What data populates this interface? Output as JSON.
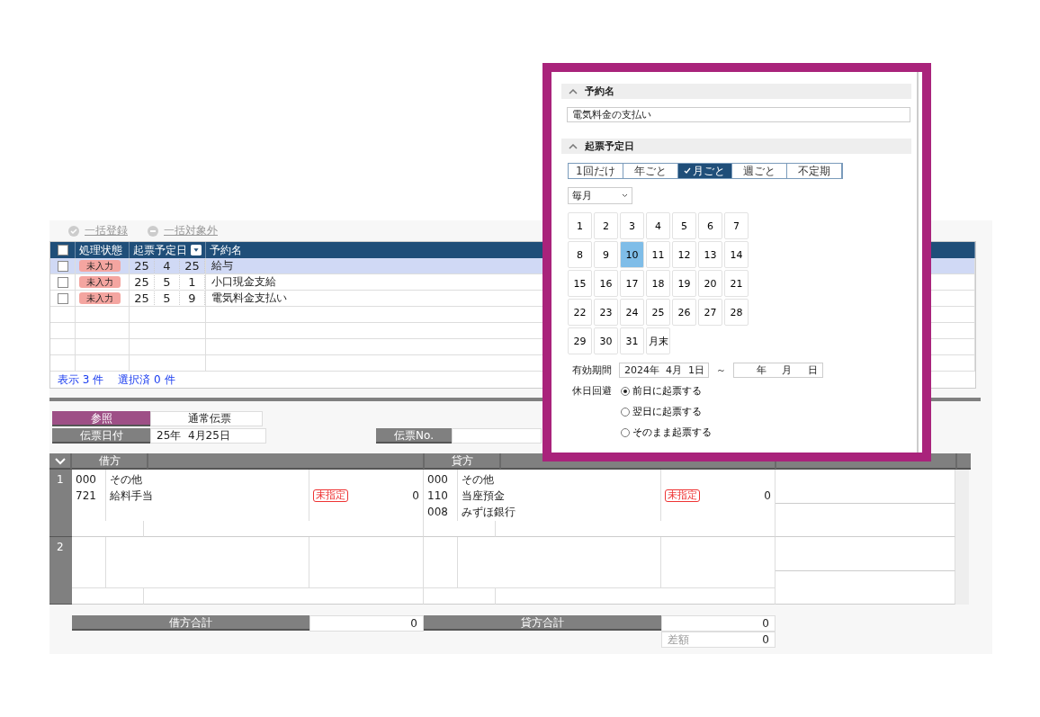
{
  "toolbar": [
    {
      "label": "一括登録",
      "kind": "register",
      "disabled": true
    },
    {
      "label": "一括対象外",
      "kind": "exclude",
      "disabled": true
    }
  ],
  "reservations": {
    "select_all_checked": false,
    "columns": [
      "処理状態",
      "起票予定日",
      "予約名"
    ],
    "rows": [
      {
        "checked": false,
        "selected": true,
        "status": "未入力",
        "date": [
          "25",
          "4",
          "25"
        ],
        "name": "給与"
      },
      {
        "checked": false,
        "selected": false,
        "status": "未入力",
        "date": [
          "25",
          "5",
          "1"
        ],
        "name": "小口現金支給"
      },
      {
        "checked": false,
        "selected": false,
        "status": "未入力",
        "date": [
          "25",
          "5",
          "9"
        ],
        "name": "電気料金支払い"
      }
    ],
    "footer": [
      "表示 3 件",
      "選択済 0 件"
    ]
  },
  "voucher": {
    "reference_label": "参照",
    "reference_value": "通常伝票",
    "date_label": "伝票日付",
    "date_value": "25年  4月25日",
    "number_label": "伝票No."
  },
  "journal": {
    "headers": {
      "debit": "借方",
      "credit": "貸方"
    },
    "rows": [
      {
        "number": "1",
        "debit": {
          "lines": [
            {
              "code": "000",
              "name": "その他"
            },
            {
              "code": "721",
              "name": "給料手当"
            }
          ],
          "tag": "未指定",
          "amount": "0"
        },
        "credit": {
          "lines": [
            {
              "code": "000",
              "name": "その他"
            },
            {
              "code": "110",
              "name": "当座預金"
            },
            {
              "code": "008",
              "name": "みずほ銀行"
            }
          ],
          "tag": "未指定",
          "amount": "0"
        }
      },
      {
        "number": "2"
      }
    ],
    "totals": {
      "debit_label": "借方合計",
      "debit_value": "0",
      "credit_label": "貸方合計",
      "credit_value": "0",
      "difference_label": "差額",
      "difference_value": "0"
    }
  },
  "popup": {
    "name_section": "予約名",
    "name_value": "電気料金の支払い",
    "date_section": "起票予定日",
    "frequency": [
      {
        "label": "1回だけ",
        "selected": false
      },
      {
        "label": "年ごと",
        "selected": false
      },
      {
        "label": "月ごと",
        "selected": true
      },
      {
        "label": "週ごと",
        "selected": false
      },
      {
        "label": "不定期",
        "selected": false
      }
    ],
    "interval": "毎月",
    "days": [
      {
        "label": "1",
        "selected": false
      },
      {
        "label": "2",
        "selected": false
      },
      {
        "label": "3",
        "selected": false
      },
      {
        "label": "4",
        "selected": false
      },
      {
        "label": "5",
        "selected": false
      },
      {
        "label": "6",
        "selected": false
      },
      {
        "label": "7",
        "selected": false
      },
      {
        "label": "8",
        "selected": false
      },
      {
        "label": "9",
        "selected": false
      },
      {
        "label": "10",
        "selected": true
      },
      {
        "label": "11",
        "selected": false
      },
      {
        "label": "12",
        "selected": false
      },
      {
        "label": "13",
        "selected": false
      },
      {
        "label": "14",
        "selected": false
      },
      {
        "label": "15",
        "selected": false
      },
      {
        "label": "16",
        "selected": false
      },
      {
        "label": "17",
        "selected": false
      },
      {
        "label": "18",
        "selected": false
      },
      {
        "label": "19",
        "selected": false
      },
      {
        "label": "20",
        "selected": false
      },
      {
        "label": "21",
        "selected": false
      },
      {
        "label": "22",
        "selected": false
      },
      {
        "label": "23",
        "selected": false
      },
      {
        "label": "24",
        "selected": false
      },
      {
        "label": "25",
        "selected": false
      },
      {
        "label": "26",
        "selected": false
      },
      {
        "label": "27",
        "selected": false
      },
      {
        "label": "28",
        "selected": false
      },
      {
        "label": "29",
        "selected": false
      },
      {
        "label": "30",
        "selected": false
      },
      {
        "label": "31",
        "selected": false
      },
      {
        "label": "月末",
        "selected": false
      }
    ],
    "period_label": "有効期間",
    "period_start": "2024年  4月  1日",
    "period_separator": "～",
    "period_end": "年　  月　  日",
    "holiday_label": "休日回避",
    "holiday_options": [
      {
        "label": "前日に起票する",
        "selected": true
      },
      {
        "label": "翌日に起票する",
        "selected": false
      },
      {
        "label": "そのまま起票する",
        "selected": false
      }
    ]
  }
}
